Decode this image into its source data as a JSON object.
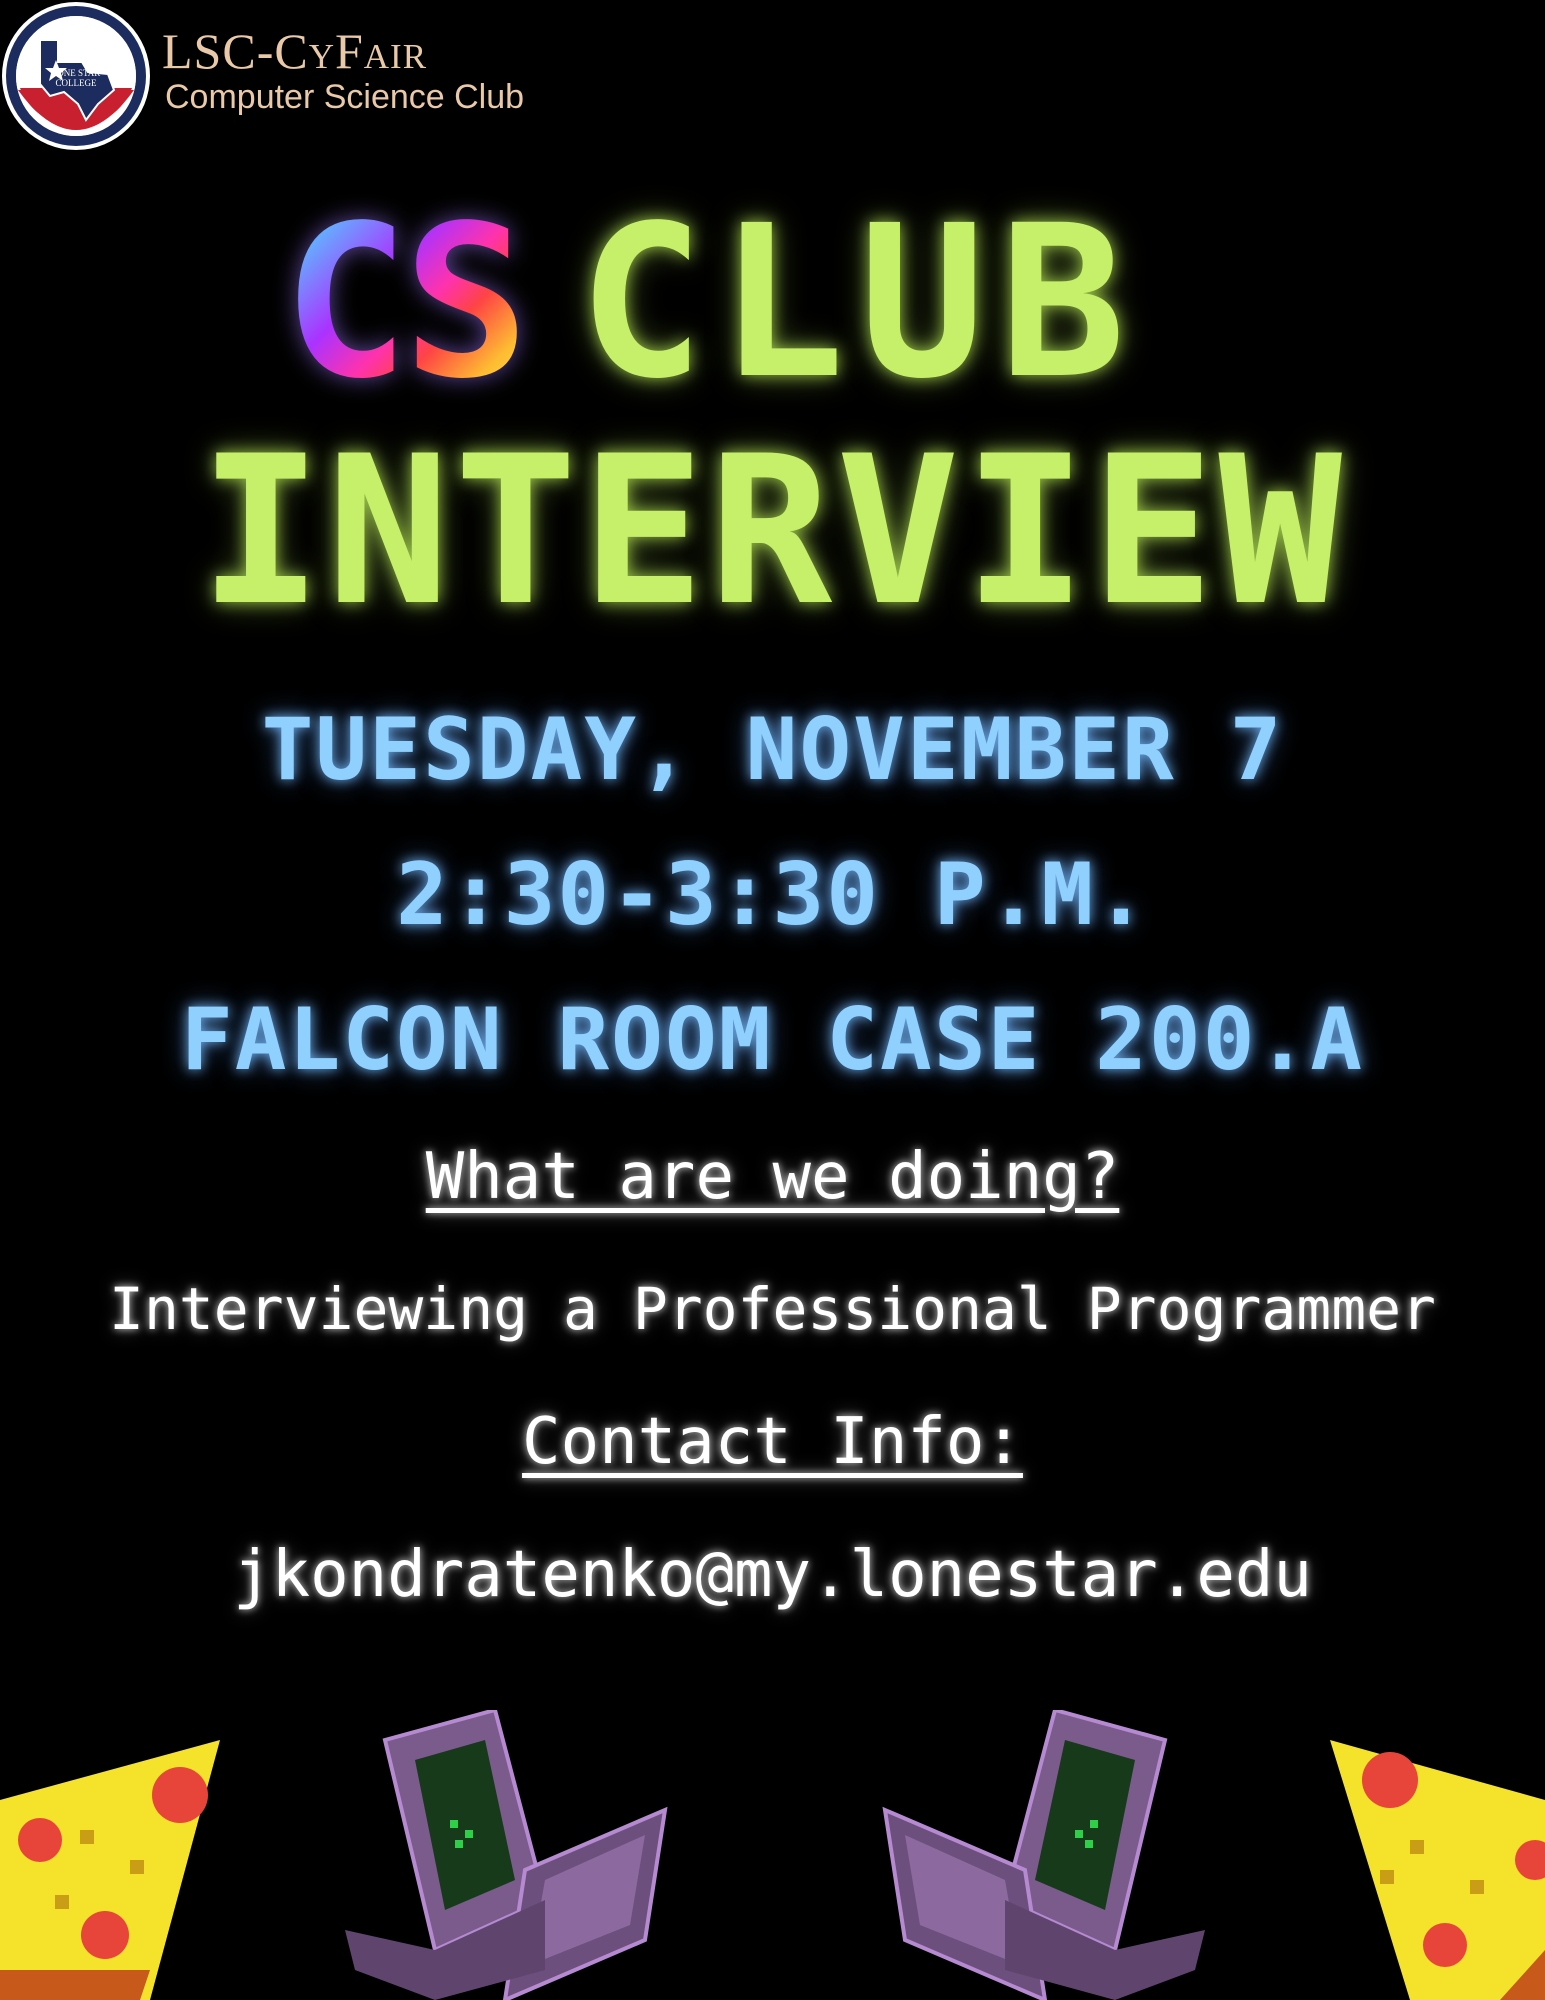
{
  "header": {
    "org_name": "LSC-CyFair",
    "org_subtitle": "Computer Science Club",
    "logo_text": "LONE STAR COLLEGE",
    "brand_colors": {
      "red": "#c8202f",
      "navy": "#1d2c5e"
    }
  },
  "title": {
    "cs": "CS",
    "club": "CLUB",
    "interview": "INTERVIEW"
  },
  "event": {
    "date": "TUESDAY, NOVEMBER 7",
    "time": "2:30-3:30 P.M.",
    "location": "FALCON ROOM CASE 200.A"
  },
  "details": {
    "question": "What are we doing?",
    "answer": "Interviewing a Professional Programmer",
    "contact_heading": "Contact Info:",
    "email": "jkondratenko@my.lonestar.edu"
  },
  "decorations": [
    "pizza-slice-icon",
    "retro-laptop-icon",
    "retro-laptop-icon",
    "pizza-slice-icon"
  ],
  "colors": {
    "title_green": "#c6f06a",
    "info_blue": "#8fd0ff",
    "text_white": "#ffffff"
  }
}
